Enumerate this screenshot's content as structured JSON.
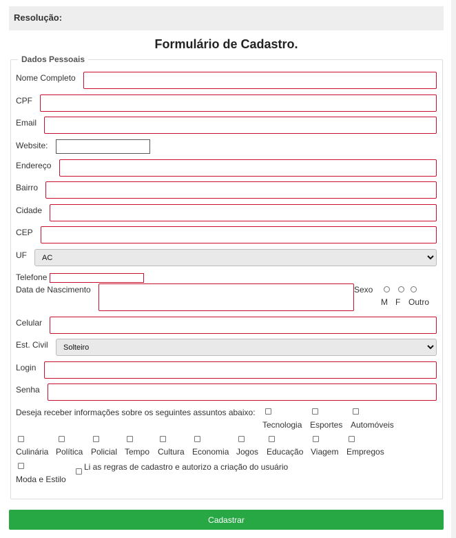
{
  "header": {
    "label": "Resolução:"
  },
  "form": {
    "title": "Formulário de Cadastro.",
    "legend": "Dados Pessoais",
    "fields": {
      "nome": "Nome Completo",
      "cpf": "CPF",
      "email": "Email",
      "website": "Website:",
      "endereco": "Endereço",
      "bairro": "Bairro",
      "cidade": "Cidade",
      "cep": "CEP",
      "uf": "UF",
      "telefone": "Telefone",
      "nascimento": "Data de Nascimento",
      "celular": "Celular",
      "estcivil": "Est. Civil",
      "login": "Login",
      "senha": "Senha"
    },
    "uf_value": "AC",
    "estcivil_value": "Solteiro",
    "sexo": {
      "label": "Sexo",
      "options": [
        "M",
        "F",
        "Outro"
      ]
    },
    "interesses": {
      "question": "Deseja receber informações sobre os seguintes assuntos abaixo:",
      "options": [
        "Tecnologia",
        "Esportes",
        "Automóveis",
        "Culinária",
        "Política",
        "Policial",
        "Tempo",
        "Cultura",
        "Economia",
        "Jogos",
        "Educação",
        "Viagem",
        "Empregos",
        "Moda e Estilo"
      ]
    },
    "terms": "Li as regras de cadastro e autorizo a criação do usuário",
    "submit_label": "Cadastrar"
  }
}
